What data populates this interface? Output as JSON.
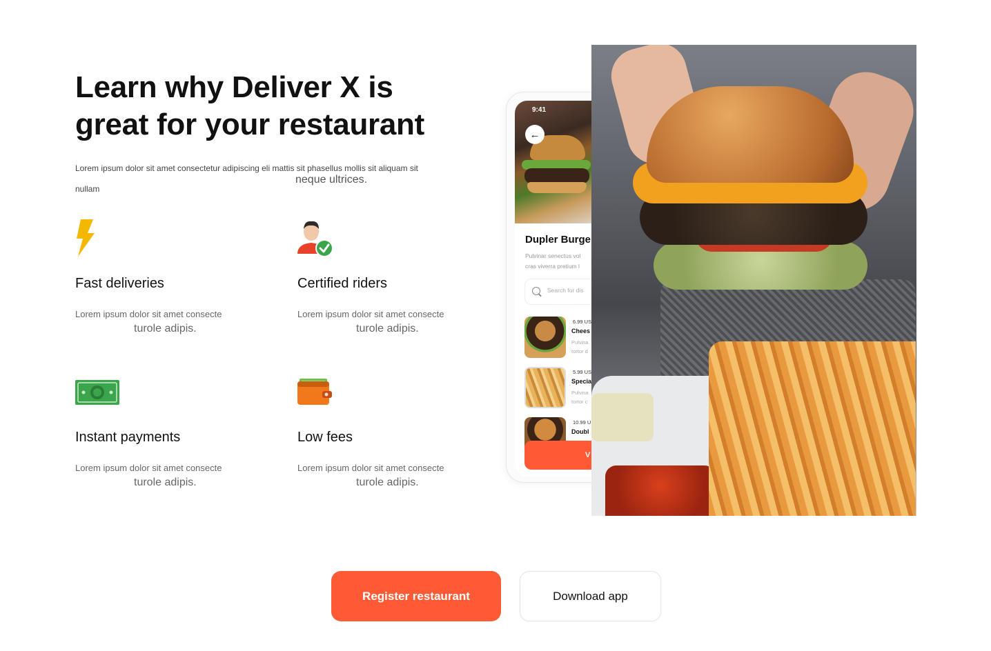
{
  "hero": {
    "headline_line1": "Learn why Deliver X is",
    "headline_line2": "great for your restaurant",
    "intro_line1": "Lorem ipsum dolor sit amet consectetur adipiscing eli mattis sit phasellus mollis sit aliquam sit",
    "intro_line2": "nullam",
    "intro_extra": "neque ultrices."
  },
  "features": [
    {
      "icon": "lightning-icon",
      "title": "Fast deliveries",
      "desc": "Lorem ipsum dolor sit amet consecte",
      "desc2": "turole adipis."
    },
    {
      "icon": "certified-rider-icon",
      "title": "Certified riders",
      "desc": "Lorem ipsum dolor sit amet consecte",
      "desc2": "turole adipis."
    },
    {
      "icon": "cash-icon",
      "title": "Instant payments",
      "desc": "Lorem ipsum dolor sit amet consecte",
      "desc2": "turole adipis."
    },
    {
      "icon": "wallet-icon",
      "title": "Low fees",
      "desc": "Lorem ipsum dolor sit amet consecte",
      "desc2": "turole adipis."
    }
  ],
  "phone": {
    "time": "9:41",
    "restaurant_name": "Dupler Burge",
    "restaurant_desc_line1": "Pulvinar senectus vol",
    "restaurant_desc_line2": "cras viverra pretium l",
    "search_placeholder": "Search for dis",
    "dishes": [
      {
        "price": "6.99 US",
        "name": "Chees",
        "desc1": "Pulvina",
        "desc2": "tortor d"
      },
      {
        "price": "5.99 US",
        "name": "Specia",
        "desc1": "Pulvina",
        "desc2": "tortor c"
      },
      {
        "price": "10.99 U",
        "name": "Doubl",
        "desc1": "",
        "desc2": ""
      }
    ],
    "view_button": "V"
  },
  "actions": {
    "primary": "Register restaurant",
    "secondary": "Download app"
  },
  "colors": {
    "accent": "#ff5a36",
    "lightning": "#f5b800",
    "cash_green": "#3aa54a",
    "wallet_orange": "#f07a1a"
  }
}
